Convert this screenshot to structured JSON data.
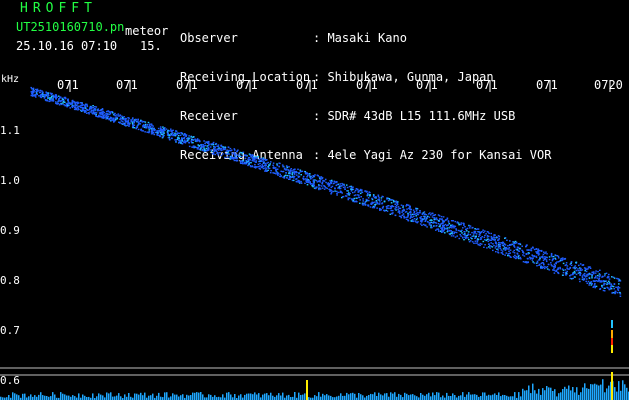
{
  "header": {
    "brand": "HROFFT",
    "filename": "UT2510160710.pn",
    "mode": "meteor",
    "datetime": "25.10.16 07:10",
    "number": "15."
  },
  "info": [
    {
      "label": "Observer",
      "value": ": Masaki Kano"
    },
    {
      "label": "Receiving Location",
      "value": ": Shibukawa, Gunma, Japan"
    },
    {
      "label": "Receiver",
      "value": ": SDR# 43dB L15 111.6MHz USB"
    },
    {
      "label": "Receiving Antenna",
      "value": ": 4ele Yagi Az 230 for Kansai VOR"
    }
  ],
  "axis": {
    "unit": "kHz",
    "y_ticks": [
      "1.1",
      "1.0",
      "0.9",
      "0.8",
      "0.7",
      "0.6"
    ],
    "x_ticks": [
      "071",
      "071",
      "071",
      "071",
      "071",
      "071",
      "071",
      "071",
      "071",
      "0720"
    ]
  },
  "colors": {
    "trace": "#1f5cff",
    "trace_core": "#22c4ff",
    "text_green": "#22ff44",
    "marker": "#ffee00"
  }
}
